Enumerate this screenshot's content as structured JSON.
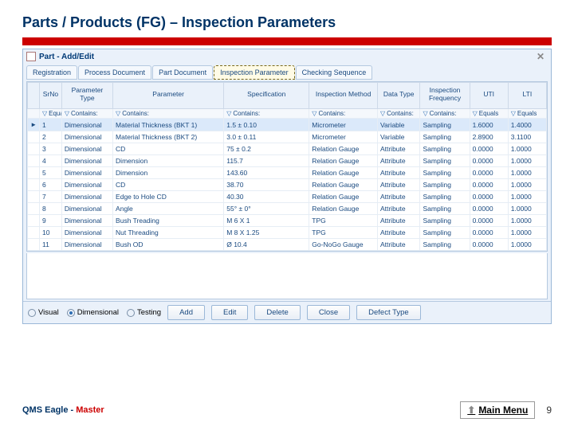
{
  "slide": {
    "title": "Parts / Products (FG) – Inspection Parameters"
  },
  "window": {
    "title": "Part - Add/Edit"
  },
  "tabs": {
    "items": [
      {
        "label": "Registration"
      },
      {
        "label": "Process Document"
      },
      {
        "label": "Part Document"
      },
      {
        "label": "Inspection Parameter"
      },
      {
        "label": "Checking Sequence"
      }
    ],
    "activeIndex": 3
  },
  "columns": {
    "srno": "SrNo",
    "ptype": "Parameter Type",
    "param": "Parameter",
    "spec": "Specification",
    "imethod": "Inspection Method",
    "dtype": "Data Type",
    "ifreq": "Inspection Frequency",
    "uti": "UTI",
    "lti": "LTI"
  },
  "filters": {
    "srno": "Equals",
    "ptype": "Contains:",
    "param": "Contains:",
    "spec": "Contains:",
    "imethod": "Contains:",
    "dtype": "Contains:",
    "ifreq": "Contains:",
    "uti": "Equals",
    "lti": "Equals"
  },
  "rows": [
    {
      "srno": "1",
      "ptype": "Dimensional",
      "param": "Material Thickness (BKT 1)",
      "spec": "1.5 ± 0.10",
      "imethod": "Micrometer",
      "dtype": "Variable",
      "ifreq": "Sampling",
      "uti": "1.6000",
      "lti": "1.4000"
    },
    {
      "srno": "2",
      "ptype": "Dimensional",
      "param": "Material Thickness (BKT 2)",
      "spec": "3.0 ± 0.11",
      "imethod": "Micrometer",
      "dtype": "Variable",
      "ifreq": "Sampling",
      "uti": "2.8900",
      "lti": "3.1100"
    },
    {
      "srno": "3",
      "ptype": "Dimensional",
      "param": "CD",
      "spec": "75 ± 0.2",
      "imethod": "Relation Gauge",
      "dtype": "Attribute",
      "ifreq": "Sampling",
      "uti": "0.0000",
      "lti": "1.0000"
    },
    {
      "srno": "4",
      "ptype": "Dimensional",
      "param": "Dimension",
      "spec": "115.7",
      "imethod": "Relation Gauge",
      "dtype": "Attribute",
      "ifreq": "Sampling",
      "uti": "0.0000",
      "lti": "1.0000"
    },
    {
      "srno": "5",
      "ptype": "Dimensional",
      "param": "Dimension",
      "spec": "143.60",
      "imethod": "Relation Gauge",
      "dtype": "Attribute",
      "ifreq": "Sampling",
      "uti": "0.0000",
      "lti": "1.0000"
    },
    {
      "srno": "6",
      "ptype": "Dimensional",
      "param": "CD",
      "spec": "38.70",
      "imethod": "Relation Gauge",
      "dtype": "Attribute",
      "ifreq": "Sampling",
      "uti": "0.0000",
      "lti": "1.0000"
    },
    {
      "srno": "7",
      "ptype": "Dimensional",
      "param": "Edge to Hole CD",
      "spec": "40.30",
      "imethod": "Relation Gauge",
      "dtype": "Attribute",
      "ifreq": "Sampling",
      "uti": "0.0000",
      "lti": "1.0000"
    },
    {
      "srno": "8",
      "ptype": "Dimensional",
      "param": "Angle",
      "spec": "55° ± 0°",
      "imethod": "Relation Gauge",
      "dtype": "Attribute",
      "ifreq": "Sampling",
      "uti": "0.0000",
      "lti": "1.0000"
    },
    {
      "srno": "9",
      "ptype": "Dimensional",
      "param": "Bush Treading",
      "spec": "M 6 X 1",
      "imethod": "TPG",
      "dtype": "Attribute",
      "ifreq": "Sampling",
      "uti": "0.0000",
      "lti": "1.0000"
    },
    {
      "srno": "10",
      "ptype": "Dimensional",
      "param": "Nut Threading",
      "spec": "M 8 X 1.25",
      "imethod": "TPG",
      "dtype": "Attribute",
      "ifreq": "Sampling",
      "uti": "0.0000",
      "lti": "1.0000"
    },
    {
      "srno": "11",
      "ptype": "Dimensional",
      "param": "Bush OD",
      "spec": "Ø 10.4",
      "imethod": "Go-NoGo Gauge",
      "dtype": "Attribute",
      "ifreq": "Sampling",
      "uti": "0.0000",
      "lti": "1.0000"
    }
  ],
  "radios": {
    "visual": "Visual",
    "dimensional": "Dimensional",
    "testing": "Testing",
    "selected": "dimensional"
  },
  "buttons": {
    "add": "Add",
    "edit": "Edit",
    "delete": "Delete",
    "close": "Close",
    "defect": "Defect Type"
  },
  "footer": {
    "brand1": "QMS Eagle - ",
    "brand2": "Master",
    "mainMenu": "Main Menu",
    "pageNum": "9"
  }
}
